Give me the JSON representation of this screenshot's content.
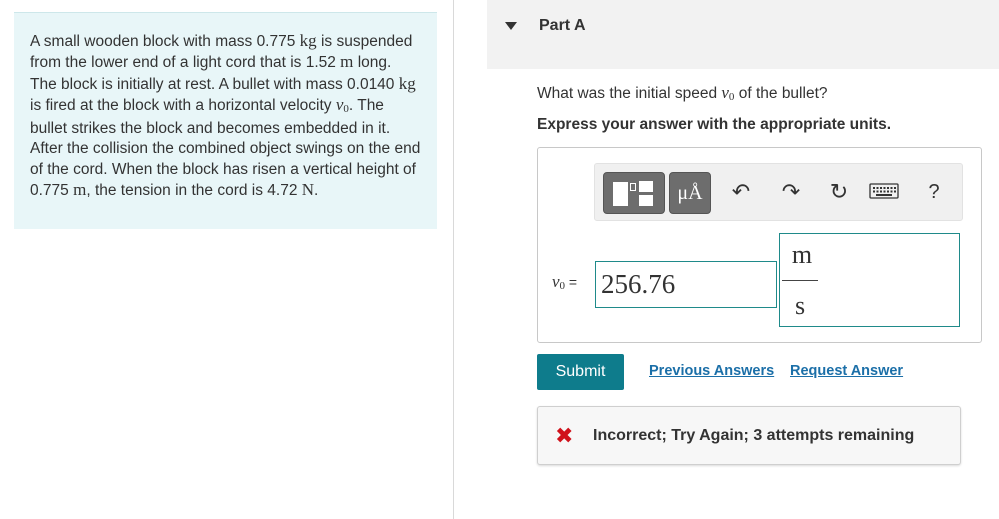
{
  "problem": {
    "t1": "A small wooden block with mass 0.775 ",
    "u_kg": "kg",
    "t2": " is suspended from the lower end of a light cord that is 1.52 ",
    "u_m": "m",
    "t3": " long. The block is initially at rest. A bullet with mass 0.0140 ",
    "u_kg2": "kg",
    "t4": " is fired at the block with a horizontal velocity ",
    "v": "v",
    "sub0": "0",
    "t5": ". The bullet strikes the block and becomes embedded in it. After the collision the combined object swings on the end of the cord. When the block has risen a vertical height of 0.775 ",
    "u_m2": "m",
    "t6": ", the tension in the cord is 4.72 ",
    "u_N": "N",
    "t7": "."
  },
  "part": {
    "title": "Part A"
  },
  "question": {
    "pre": "What was the initial speed ",
    "v": "v",
    "sub0": "0",
    "post": " of the bullet?",
    "instruction": "Express your answer with the appropriate units."
  },
  "toolbar": {
    "units_label": "μÅ",
    "undo_icon": "↶",
    "redo_icon": "↷",
    "reset_icon": "↻",
    "help_label": "?"
  },
  "answer": {
    "var": "v",
    "sub0": "0",
    "equals": " =",
    "value": "256.76",
    "unit_numerator": "m",
    "unit_denominator": "s"
  },
  "actions": {
    "submit": "Submit",
    "previous_answers": "Previous Answers",
    "request_answer": "Request Answer"
  },
  "feedback": {
    "icon": "✖",
    "text": "Incorrect; Try Again; 3 attempts remaining",
    "icon_color": "#d0111b"
  }
}
